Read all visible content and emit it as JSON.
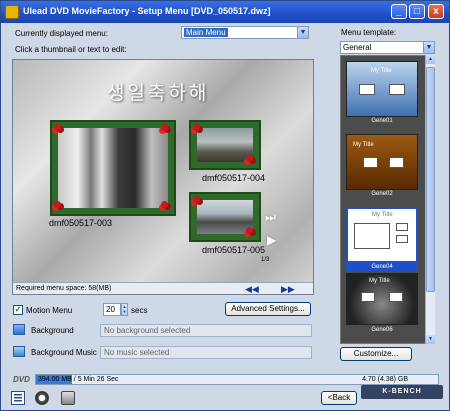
{
  "window": {
    "title": "Ulead DVD MovieFactory - Setup Menu [DVD_050517.dwz]",
    "min": "_",
    "max": "□",
    "close": "x"
  },
  "controls": {
    "displayed_menu_label": "Currently displayed menu:",
    "displayed_menu_value": "Main Menu",
    "click_hint": "Click a thumbnail or text to edit:",
    "template_label": "Menu template:",
    "template_value": "General"
  },
  "preview": {
    "menu_title": "생일축하해",
    "thumbs": [
      {
        "caption": "dmf050517-003"
      },
      {
        "caption": "dmf050517-004"
      },
      {
        "caption": "dmf050517-005"
      }
    ],
    "page_indicator": "1/3",
    "space_required": "Required menu space: 58(MB)"
  },
  "options": {
    "motion_menu_label": "Motion Menu",
    "motion_menu_checked": true,
    "motion_seconds": "20",
    "secs_label": "secs",
    "advanced_button": "Advanced Settings...",
    "background_label": "Background",
    "background_value": "No background selected",
    "music_label": "Background Music",
    "music_value": "No music selected",
    "customize_button": "Customize..."
  },
  "templates": [
    {
      "caption": "Gene01",
      "title": "My Title",
      "selected": false
    },
    {
      "caption": "Gene02",
      "title": "My Title",
      "selected": false
    },
    {
      "caption": "Gene04",
      "title": "My Title",
      "selected": true
    },
    {
      "caption": "Gene06",
      "title": "My Title",
      "selected": false
    }
  ],
  "status": {
    "disc_label": "DVD",
    "used": "394.00 MB / 5 Min 26 Sec",
    "capacity": "4.70 (4.38) GB",
    "used_fraction": 0.09
  },
  "footer": {
    "back_button": "<Back",
    "watermark": "K-BENCH"
  },
  "colors": {
    "titlebar": "#1f4fc8",
    "selection": "#316ac5",
    "frame_green": "#2f6a2a",
    "berry_red": "#c61a1a"
  }
}
